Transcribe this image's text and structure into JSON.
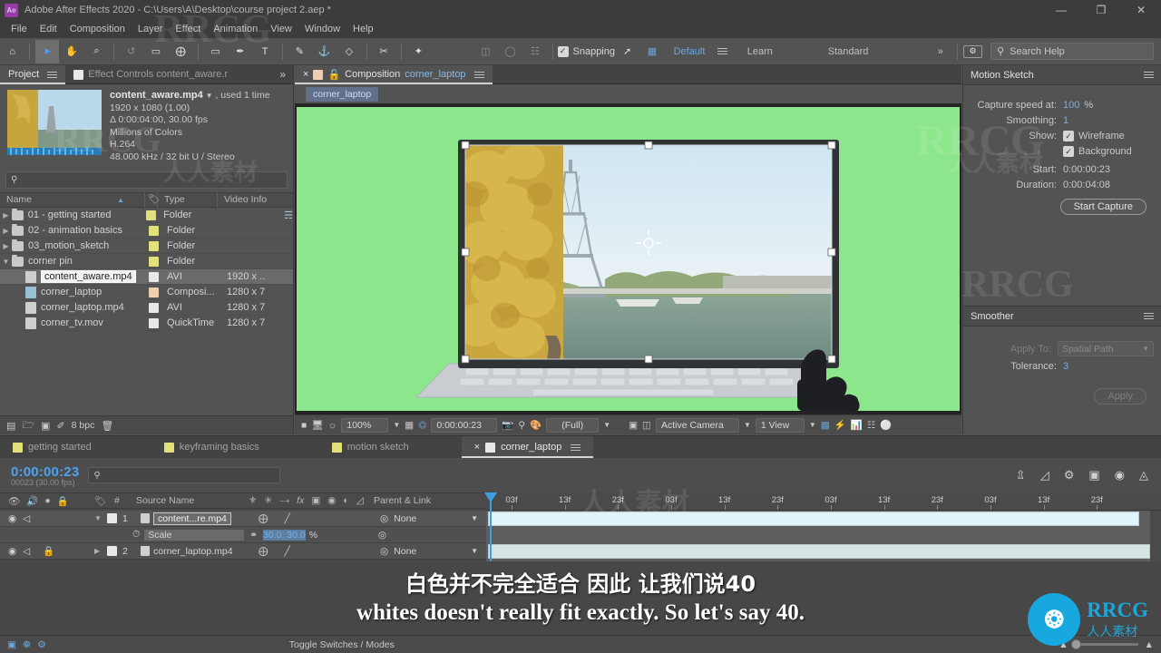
{
  "window": {
    "app_icon": "ae-logo-icon",
    "title": "Adobe After Effects 2020 - C:\\Users\\A\\Desktop\\course project 2.aep *",
    "minimize": "—",
    "maximize": "❐",
    "close": "✕"
  },
  "menu": [
    "File",
    "Edit",
    "Composition",
    "Layer",
    "Effect",
    "Animation",
    "View",
    "Window",
    "Help"
  ],
  "toolbar": {
    "tools": [
      {
        "name": "home-icon",
        "glyph": "⌂"
      },
      {
        "name": "selection-tool-icon",
        "glyph": "➤"
      },
      {
        "name": "hand-tool-icon",
        "glyph": "✋"
      },
      {
        "name": "zoom-tool-icon",
        "glyph": "⌕"
      },
      {
        "name": "rotation-tool-icon",
        "glyph": "↺"
      },
      {
        "name": "camera-tool-icon",
        "glyph": "▭"
      },
      {
        "name": "anchor-point-tool-icon",
        "glyph": "⨁"
      },
      {
        "name": "rectangle-tool-icon",
        "glyph": "▭"
      },
      {
        "name": "pen-tool-icon",
        "glyph": "✒"
      },
      {
        "name": "type-tool-icon",
        "glyph": "T"
      },
      {
        "name": "brush-tool-icon",
        "glyph": "✎"
      },
      {
        "name": "clone-stamp-tool-icon",
        "glyph": "⚓"
      },
      {
        "name": "eraser-tool-icon",
        "glyph": "◇"
      },
      {
        "name": "roto-brush-tool-icon",
        "glyph": "✂"
      },
      {
        "name": "puppet-pin-tool-icon",
        "glyph": "✦"
      }
    ],
    "align_icons": [
      "align-left-icon",
      "align-center-icon",
      "distribute-icon"
    ],
    "snapping_label": "Snapping",
    "snapping_checked": "✓",
    "snap_extra_icons": [
      "snap-path-icon",
      "snap-grid-icon"
    ],
    "workspaces": [
      "Default",
      "Learn",
      "Standard"
    ],
    "active_workspace": "Default",
    "overflow": "»",
    "workspace_menu_icon": "workspace-settings-icon",
    "search_placeholder": "Search Help",
    "search_value": "Search Help"
  },
  "project": {
    "tabs": [
      {
        "label": "Project",
        "active": true
      },
      {
        "label": "Effect Controls content_aware.r",
        "active": false
      }
    ],
    "overflow": "»",
    "selected_item": {
      "name": "content_aware.mp4",
      "used": ", used 1 time",
      "dimensions": "1920 x 1080 (1.00)",
      "duration": "Δ 0:00:04:00, 30.00 fps",
      "colors": "Millions of Colors",
      "codec": "H.264",
      "audio": "48.000 kHz / 32 bit U / Stereo"
    },
    "search_placeholder": "",
    "columns": [
      "Name",
      "Type",
      "Video Info"
    ],
    "sort_indicator": "▲",
    "rows": [
      {
        "name": "01 - getting started",
        "type": "Folder",
        "info": "",
        "kind": "folder",
        "expanded": false,
        "indent": 0,
        "color": "#e2e07a",
        "selected": false
      },
      {
        "name": "02 - animation basics",
        "type": "Folder",
        "info": "",
        "kind": "folder",
        "expanded": false,
        "indent": 0,
        "color": "#e2e07a",
        "selected": false
      },
      {
        "name": "03_motion_sketch",
        "type": "Folder",
        "info": "",
        "kind": "folder",
        "expanded": false,
        "indent": 0,
        "color": "#e2e07a",
        "selected": false
      },
      {
        "name": "corner pin",
        "type": "Folder",
        "info": "",
        "kind": "folder",
        "expanded": true,
        "indent": 0,
        "color": "#e2e07a",
        "selected": false
      },
      {
        "name": "content_aware.mp4",
        "type": "AVI",
        "info": "1920 x ..",
        "kind": "file",
        "indent": 1,
        "color": "#e8e8e8",
        "selected": true
      },
      {
        "name": "corner_laptop",
        "type": "Composi...",
        "info": "1280 x 7",
        "kind": "comp",
        "indent": 1,
        "color": "#f0cfb0",
        "selected": false
      },
      {
        "name": "corner_laptop.mp4",
        "type": "AVI",
        "info": "1280 x 7",
        "kind": "file",
        "indent": 1,
        "color": "#e8e8e8",
        "selected": false
      },
      {
        "name": "corner_tv.mov",
        "type": "QuickTime",
        "info": "1280 x 7",
        "kind": "file",
        "indent": 1,
        "color": "#e8e8e8",
        "selected": false
      }
    ],
    "footer": {
      "bit_depth": "8 bpc",
      "icons": [
        "interpret-footage-icon",
        "new-folder-icon",
        "new-composition-icon",
        "project-settings-icon",
        "delete-icon"
      ]
    }
  },
  "composition": {
    "close_icon": "×",
    "lock_icon": "lock-icon",
    "tab_prefix": "Composition",
    "tab_name": "corner_laptop",
    "breadcrumb": "corner_laptop",
    "stage_bg_color": "#8ce68c",
    "footer": {
      "zoom": "100%",
      "time": "0:00:00:23",
      "resolution": "(Full)",
      "view_camera": "Active Camera",
      "view_layout": "1 View",
      "icons_left": [
        "always-preview-icon",
        "main-view-icon",
        "3d-glasses-icon"
      ],
      "icons_mid": [
        "grid-icon",
        "mask-icon",
        "snapshot-icon",
        "show-snapshot-icon",
        "channel-icon"
      ],
      "icons_right": [
        "region-of-interest-icon",
        "transparency-grid-icon",
        "toggle-view-layout-icon",
        "pixel-aspect-icon",
        "fast-previews-icon",
        "timeline-icon",
        "comp-flowchart-icon",
        "reset-exposure-icon"
      ]
    }
  },
  "motion_sketch": {
    "title": "Motion Sketch",
    "menu_icon": "panel-menu-icon",
    "capture_speed_label": "Capture speed at:",
    "capture_speed_value": "100",
    "capture_speed_unit": "%",
    "smoothing_label": "Smoothing:",
    "smoothing_value": "1",
    "show_label": "Show:",
    "wireframe_label": "Wireframe",
    "wireframe_checked": "✓",
    "background_label": "Background",
    "background_checked": "✓",
    "start_label": "Start:",
    "start_value": "0:00:00:23",
    "duration_label": "Duration:",
    "duration_value": "0:00:04:08",
    "button": "Start Capture"
  },
  "smoother": {
    "title": "Smoother",
    "menu_icon": "panel-menu-icon",
    "apply_to_label": "Apply To:",
    "apply_to_value": "Spatial Path",
    "tolerance_label": "Tolerance:",
    "tolerance_value": "3",
    "button": "Apply"
  },
  "timeline": {
    "tabs": [
      {
        "label": "getting started",
        "active": false,
        "color": "#e2e07a"
      },
      {
        "label": "keyframing basics",
        "active": false,
        "color": "#e2e07a"
      },
      {
        "label": "motion sketch",
        "active": false,
        "color": "#e2e07a"
      },
      {
        "label": "corner_laptop",
        "active": true,
        "color": "#e8e8e8"
      }
    ],
    "close_icon": "×",
    "menu_icon": "panel-menu-icon",
    "current_time": "0:00:00:23",
    "frame_info": "00023 (30.00 fps)",
    "search_placeholder": "",
    "toolbar_icons": [
      "live-update-icon",
      "draft-3d-icon",
      "hide-shy-layers-icon",
      "frame-blending-icon",
      "motion-blur-icon",
      "graph-editor-icon"
    ],
    "columns": {
      "eye": "eye-icon",
      "audio": "audio-icon",
      "solo": "solo-icon",
      "lock": "lock-icon",
      "label": "label-icon",
      "num": "#",
      "source_name": "Source Name",
      "switches": [
        "shy-icon",
        "collapse-icon",
        "quality-icon",
        "fx-icon",
        "frame-blend-icon",
        "motion-blur-icon",
        "adjustment-icon",
        "3d-layer-icon"
      ],
      "parent": "Parent & Link"
    },
    "layers": [
      {
        "num": "1",
        "name": "content...re.mp4",
        "parent": "None",
        "locked": false,
        "selected": true,
        "color": "#e8e8e8",
        "bar_color": "#dff4fb",
        "expanded": true
      },
      {
        "num": "2",
        "name": "corner_laptop.mp4",
        "parent": "None",
        "locked": true,
        "selected": false,
        "color": "#e8e8e8",
        "bar_color": "#d6e4e4",
        "expanded": false
      }
    ],
    "property": {
      "stopwatch_icon": "stopwatch-icon",
      "name": "Scale",
      "link_icon": "constrain-proportions-icon",
      "value": "30.0, 30.0",
      "unit": "%",
      "parent_icon": "parent-pick-whip-icon"
    },
    "ruler_labels": [
      "03f",
      "13f",
      "23f",
      "03f",
      "13f",
      "23f",
      "03f",
      "13f",
      "23f",
      "03f",
      "13f",
      "23f"
    ],
    "footer": {
      "label": "Toggle Switches / Modes",
      "icons": [
        "comp-mini-flowchart-icon",
        "comp-render-icon",
        "brainstorm-icon"
      ],
      "zoom_icons": [
        "zoom-out-icon",
        "zoom-slider-icon",
        "zoom-in-icon"
      ]
    }
  },
  "subtitles": {
    "chinese": "白色并不完全适合 因此 让我们说40",
    "english": "whites doesn't really fit exactly. So let's say 40."
  },
  "watermarks": {
    "brand": "RRCG",
    "brand_cn": "人人素材",
    "logo_glyph": "❂"
  }
}
